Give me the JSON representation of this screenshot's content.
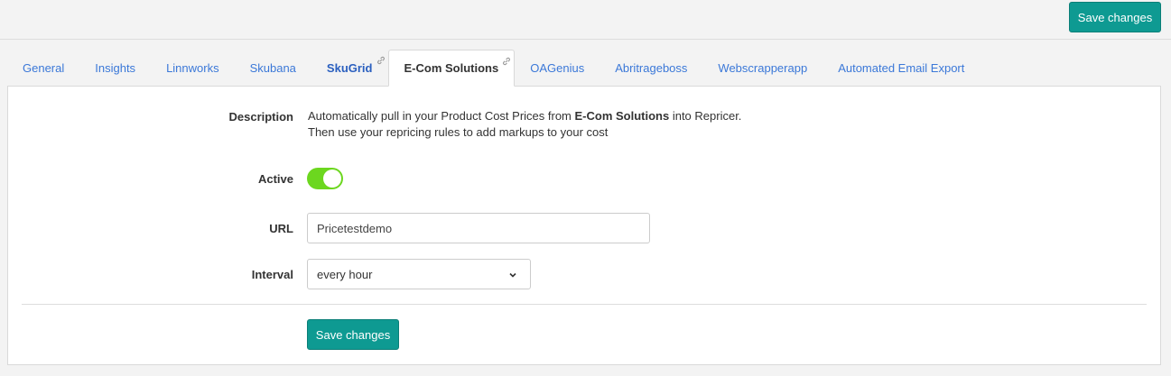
{
  "toolbar": {
    "save_label": "Save changes"
  },
  "tabs": [
    {
      "label": "General"
    },
    {
      "label": "Insights"
    },
    {
      "label": "Linnworks"
    },
    {
      "label": "Skubana"
    },
    {
      "label": "SkuGrid",
      "icon": "link-icon"
    },
    {
      "label": "E-Com Solutions",
      "icon": "link-icon",
      "active": true
    },
    {
      "label": "OAGenius"
    },
    {
      "label": "Abritrageboss"
    },
    {
      "label": "Webscrapperapp"
    },
    {
      "label": "Automated Email Export"
    }
  ],
  "form": {
    "description_label": "Description",
    "description_line1_pre": "Automatically pull in your Product Cost Prices from ",
    "description_line1_bold": "E-Com Solutions",
    "description_line1_post": " into Repricer.",
    "description_line2": "Then use your repricing rules to add markups to your cost",
    "active_label": "Active",
    "active_value": true,
    "url_label": "URL",
    "url_value": "Pricetestdemo",
    "interval_label": "Interval",
    "interval_value": "every hour",
    "save_label": "Save changes"
  },
  "colors": {
    "accent": "#0e9a92",
    "toggle_on": "#6cd71f",
    "link": "#3b78d8"
  }
}
